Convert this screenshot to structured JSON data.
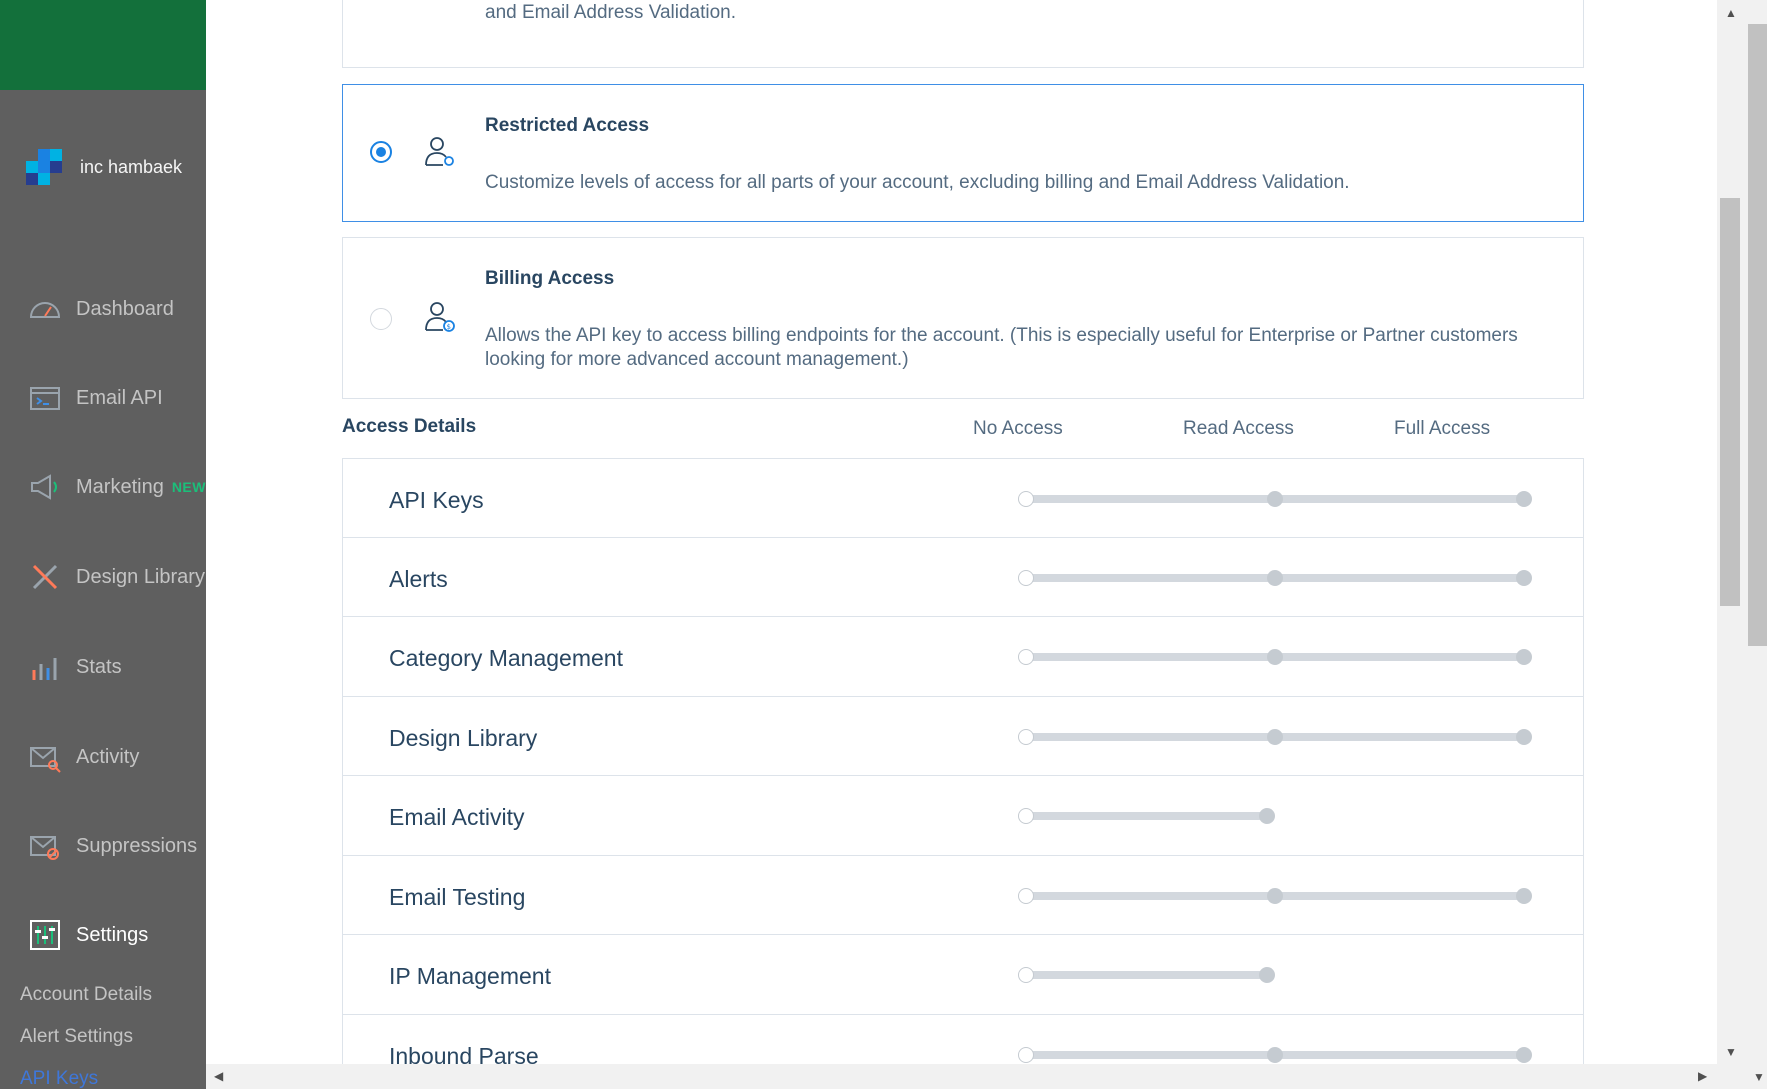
{
  "sidebar": {
    "account_name": "inc hambaek",
    "nav": [
      {
        "label": "Dashboard",
        "icon": "dashboard-icon"
      },
      {
        "label": "Email API",
        "icon": "email-api-icon"
      },
      {
        "label": "Marketing",
        "icon": "megaphone-icon",
        "badge": "NEW"
      },
      {
        "label": "Design Library",
        "icon": "design-library-icon"
      },
      {
        "label": "Stats",
        "icon": "stats-icon"
      },
      {
        "label": "Activity",
        "icon": "activity-icon"
      },
      {
        "label": "Suppressions",
        "icon": "suppressions-icon"
      },
      {
        "label": "Settings",
        "icon": "settings-icon"
      }
    ],
    "sub_items": [
      "Account Details",
      "Alert Settings",
      "API Keys"
    ]
  },
  "permissions": {
    "top_partial_desc": "Allows the API key to access GET, PATCH, PUT, DELETE, and POST endpoints for all parts of your account, excluding billing and Email Address Validation.",
    "restricted": {
      "title": "Restricted Access",
      "desc": "Customize levels of access for all parts of your account, excluding billing and Email Address Validation."
    },
    "billing": {
      "title": "Billing Access",
      "desc": "Allows the API key to access billing endpoints for the account. (This is especially useful for Enterprise or Partner customers looking for more advanced account management.)"
    }
  },
  "access_details": {
    "title": "Access Details",
    "columns": [
      "No Access",
      "Read Access",
      "Full Access"
    ],
    "rows": [
      {
        "label": "API Keys",
        "levels": 3,
        "value": 0
      },
      {
        "label": "Alerts",
        "levels": 3,
        "value": 0
      },
      {
        "label": "Category Management",
        "levels": 3,
        "value": 0
      },
      {
        "label": "Design Library",
        "levels": 3,
        "value": 0
      },
      {
        "label": "Email Activity",
        "levels": 2,
        "value": 0
      },
      {
        "label": "Email Testing",
        "levels": 3,
        "value": 0
      },
      {
        "label": "IP Management",
        "levels": 2,
        "value": 0
      },
      {
        "label": "Inbound Parse",
        "levels": 3,
        "value": 0
      }
    ]
  },
  "colors": {
    "brand_green": "#13703b",
    "accent_blue": "#1a82e2",
    "sidebar_bg": "#5f5f5f"
  }
}
